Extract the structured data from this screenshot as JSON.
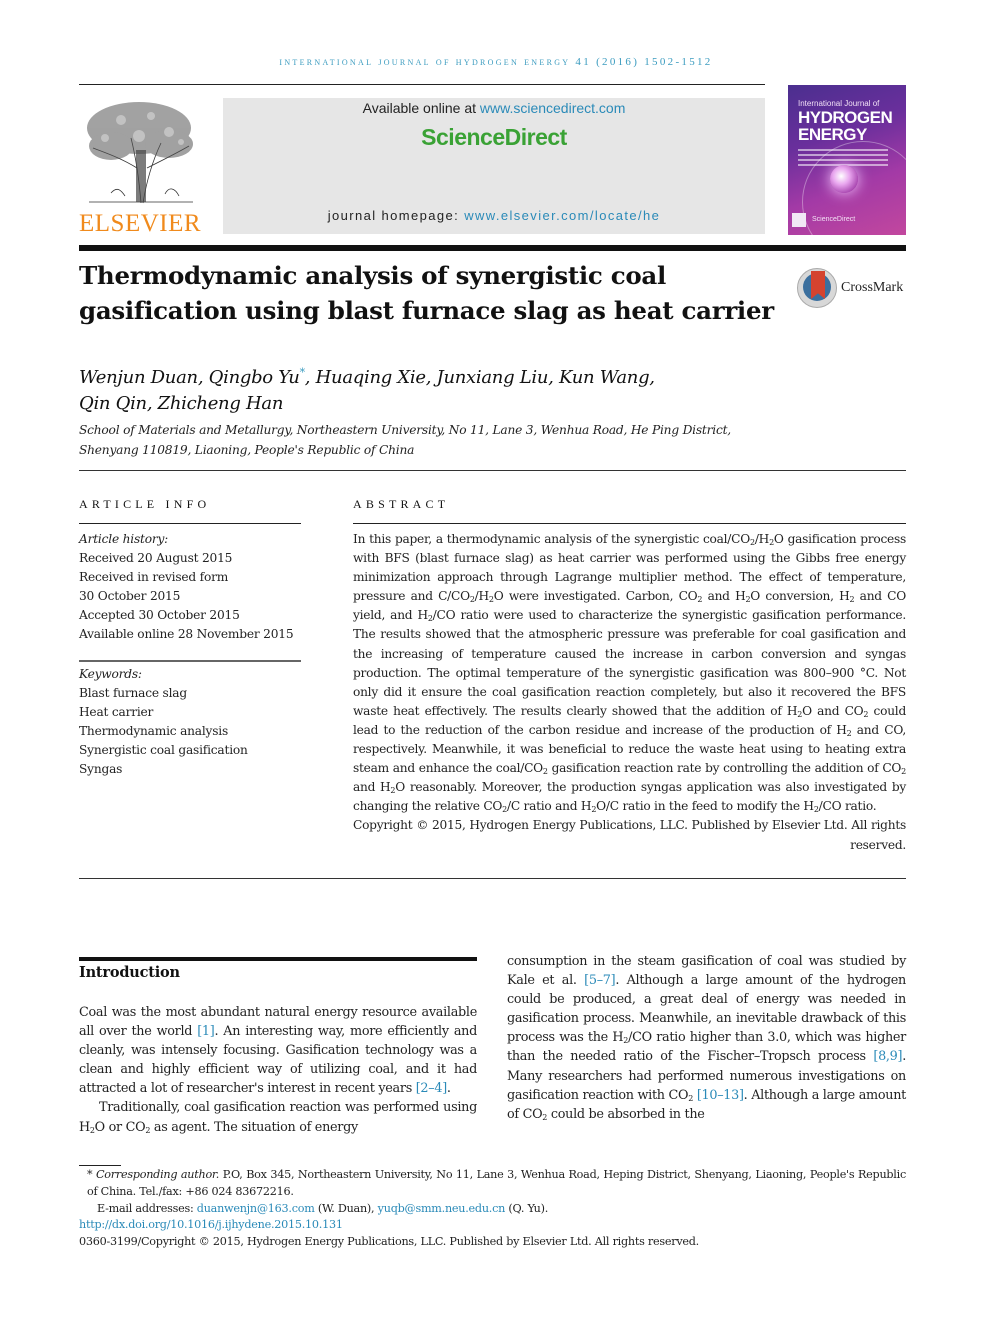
{
  "header": {
    "running_head": "International Journal of Hydrogen Energy 41 (2016) 1502-1512",
    "available_online_prefix": "Available online at ",
    "sciencedirect_url": "www.sciencedirect.com",
    "sciencedirect_brand": "ScienceDirect",
    "homepage_prefix": "journal homepage: ",
    "homepage_url": "www.elsevier.com/locate/he",
    "publisher_logo_text": "ELSEVIER",
    "cover": {
      "line1": "International Journal of",
      "line2": "HYDROGEN",
      "line3": "ENERGY",
      "footer": "ScienceDirect"
    },
    "crossmark_label": "CrossMark"
  },
  "article": {
    "title": "Thermodynamic analysis of synergistic coal gasification using blast furnace slag as heat carrier",
    "authors": {
      "before_star": "Wenjun Duan, Qingbo Yu",
      "star": "*",
      "line1_after": ", Huaqing Xie, Junxiang Liu, Kun Wang,",
      "line2": "Qin Qin, Zhicheng Han"
    },
    "affiliation_line1": "School of Materials and Metallurgy, Northeastern University, No 11, Lane 3, Wenhua Road, He Ping District,",
    "affiliation_line2": "Shenyang 110819, Liaoning, People's Republic of China"
  },
  "article_info": {
    "label": "ARTICLE INFO",
    "history_heading": "Article history:",
    "history": [
      "Received 20 August 2015",
      "Received in revised form",
      "30 October 2015",
      "Accepted 30 October 2015",
      "Available online 28 November 2015"
    ],
    "keywords_heading": "Keywords:",
    "keywords": [
      "Blast furnace slag",
      "Heat carrier",
      "Thermodynamic analysis",
      "Synergistic coal gasification",
      "Syngas"
    ]
  },
  "abstract": {
    "label": "ABSTRACT",
    "seg": [
      "In this paper, a thermodynamic analysis of the synergistic coal/CO",
      "/H",
      "O gasification process with BFS (blast furnace slag) as heat carrier was performed using the Gibbs free energy minimization approach through Lagrange multiplier method. The effect of temperature, pressure and C/CO",
      "/H",
      "O were investigated. Carbon, CO",
      " and H",
      "O conversion, H",
      " and CO yield, and H",
      "/CO ratio were used to characterize the synergistic gasification performance. The results showed that the atmospheric pressure was preferable for coal gasification and the increasing of temperature caused the increase in carbon conversion and syngas production. The optimal temperature of the synergistic gasification was 800–900 °C. Not only did it ensure the coal gasification reaction completely, but also it recovered the BFS waste heat effectively. The results clearly showed that the addition of H",
      "O and CO",
      " could lead to the reduction of the carbon residue and increase of the production of H",
      " and CO, respectively. Meanwhile, it was beneficial to reduce the waste heat using to heating extra steam and enhance the coal/CO",
      " gasification reaction rate by controlling the addition of CO",
      " and H",
      "O reasonably. Moreover, the production syngas application was also investigated by changing the relative CO",
      "/C ratio and H",
      "O/C ratio in the feed to modify the H",
      "/CO ratio."
    ],
    "subscript": "2",
    "copyright": "Copyright © 2015, Hydrogen Energy Publications, LLC. Published by Elsevier Ltd. All rights reserved."
  },
  "introduction": {
    "heading": "Introduction",
    "p1": [
      "Coal was the most abundant natural energy resource available all over the world ",
      "[1]",
      ". An interesting way, more efficiently and cleanly, was intensely focusing. Gasification technology was a clean and highly efficient way of utilizing coal, and it had attracted a lot of researcher's interest in recent years ",
      "[2–4]",
      "."
    ],
    "p2": [
      "Traditionally, coal gasification reaction was performed using H",
      "O or CO",
      " as agent. The situation of energy consumption in the steam gasification of coal was studied by Kale et al. ",
      "[5–7]",
      ". Although a large amount of the hydrogen could be produced, a great deal of energy was needed in gasification process. Meanwhile, an inevitable drawback of this process was the H",
      "/CO ratio higher than 3.0, which was higher than the needed ratio of the Fischer–Tropsch process ",
      "[8,9]",
      ". Many researchers had performed numerous investigations on gasification reaction with CO",
      " ",
      "[10–13]",
      ". Although a large amount of CO",
      " could be absorbed in the"
    ]
  },
  "footnotes": {
    "corresponding_label": "* Corresponding author.",
    "corresponding_text": " P.O, Box 345, Northeastern University, No 11, Lane 3, Wenhua Road, Heping District, Shenyang, Liaoning, People's Republic of China. Tel./fax: +86 024 83672216.",
    "email_prefix": "E-mail addresses: ",
    "email1": "duanwenjn@163.com",
    "email1_owner": " (W. Duan), ",
    "email2": "yuqb@smm.neu.edu.cn",
    "email2_owner": " (Q. Yu).",
    "doi": "http://dx.doi.org/10.1016/j.ijhydene.2015.10.131",
    "issn_copyright": "0360-3199/Copyright © 2015, Hydrogen Energy Publications, LLC. Published by Elsevier Ltd. All rights reserved."
  },
  "colors": {
    "link": "#2a8ab8",
    "sciencedirect_green": "#3aa235",
    "elsevier_orange": "#f08a1c",
    "running_head": "#3a9bbf"
  }
}
